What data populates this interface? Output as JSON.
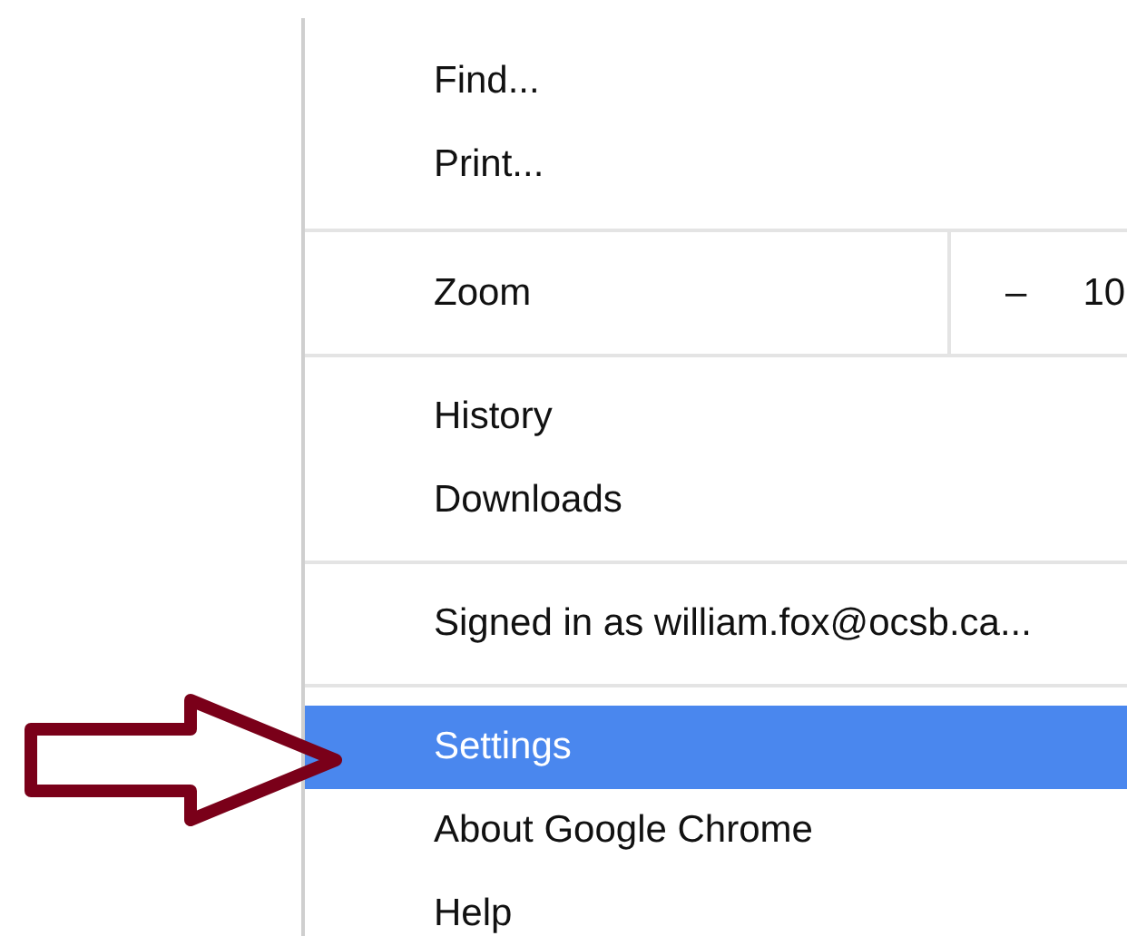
{
  "menu": {
    "sections": [
      {
        "items": [
          {
            "kind": "plain",
            "label": "Find...",
            "selected": false
          },
          {
            "kind": "plain",
            "label": "Print...",
            "selected": false
          }
        ]
      },
      {
        "items": [
          {
            "kind": "zoom",
            "label": "Zoom",
            "minus": "–",
            "value": "10"
          }
        ]
      },
      {
        "items": [
          {
            "kind": "plain",
            "label": "History",
            "selected": false
          },
          {
            "kind": "plain",
            "label": "Downloads",
            "selected": false
          }
        ]
      },
      {
        "items": [
          {
            "kind": "plain",
            "label": "Signed in as william.fox@ocsb.ca...",
            "selected": false
          }
        ]
      },
      {
        "items": [
          {
            "kind": "plain",
            "label": "Settings",
            "selected": true
          },
          {
            "kind": "plain",
            "label": "About Google Chrome",
            "selected": false
          },
          {
            "kind": "plain",
            "label": "Help",
            "selected": false
          }
        ]
      }
    ]
  }
}
